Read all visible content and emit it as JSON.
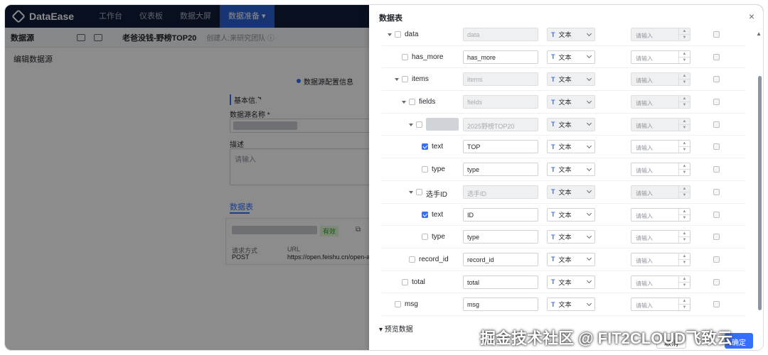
{
  "app": {
    "logo": "DataEase",
    "nav": [
      "工作台",
      "仪表板",
      "数据大屏",
      "数据准备"
    ],
    "active_nav": "数据准备 ▾"
  },
  "subbar": {
    "title": "数据源",
    "datasource_name": "老爸没钱-野榜TOP20",
    "hint": "创建人:来研究团队 ⓘ"
  },
  "edit_title": "编辑数据源",
  "form": {
    "step_label": "数据源配置信息",
    "section_basic": "基本信息",
    "name_label": "数据源名称 *",
    "desc_label": "描述",
    "desc_placeholder": "请输入",
    "tab_tables": "数据表",
    "card_status": "有效",
    "card_method_label": "请求方式",
    "card_method_value": "POST",
    "card_url_label": "URL",
    "card_url_value": "https://open.feishu.cn/open-apis"
  },
  "drawer": {
    "title": "数据表",
    "close": "×",
    "preview_label": "▾ 预览数据",
    "cancel": "取消",
    "ok": "确定",
    "rows": [
      {
        "name": "data",
        "field": "data",
        "type": "文本",
        "checked": false,
        "indent": 0,
        "caret": true,
        "disabled": true
      },
      {
        "name": "has_more",
        "field": "has_more",
        "type": "文本",
        "checked": false,
        "indent": 1,
        "caret": false,
        "disabled": false
      },
      {
        "name": "items",
        "field": "items",
        "type": "文本",
        "checked": false,
        "indent": 1,
        "caret": true,
        "disabled": true
      },
      {
        "name": "fields",
        "field": "fields",
        "type": "文本",
        "checked": false,
        "indent": 2,
        "caret": true,
        "disabled": true
      },
      {
        "name": "",
        "field": "2025野榜TOP20",
        "type": "文本",
        "checked": false,
        "indent": 3,
        "caret": true,
        "disabled": true,
        "blurred": true
      },
      {
        "name": "text",
        "field": "TOP",
        "type": "文本",
        "checked": true,
        "indent": 4,
        "caret": false,
        "disabled": false
      },
      {
        "name": "type",
        "field": "type",
        "type": "文本",
        "checked": false,
        "indent": 4,
        "caret": false,
        "disabled": false
      },
      {
        "name": "选手ID",
        "field": "选手ID",
        "type": "文本",
        "checked": false,
        "indent": 3,
        "caret": true,
        "disabled": true
      },
      {
        "name": "text",
        "field": "ID",
        "type": "文本",
        "checked": true,
        "indent": 4,
        "caret": false,
        "disabled": false
      },
      {
        "name": "type",
        "field": "type",
        "type": "文本",
        "checked": false,
        "indent": 4,
        "caret": false,
        "disabled": false
      },
      {
        "name": "record_id",
        "field": "record_id",
        "type": "文本",
        "checked": false,
        "indent": 2,
        "caret": false,
        "disabled": false
      },
      {
        "name": "total",
        "field": "total",
        "type": "文本",
        "checked": false,
        "indent": 1,
        "caret": false,
        "disabled": false
      },
      {
        "name": "msg",
        "field": "msg",
        "type": "文本",
        "checked": false,
        "indent": 0,
        "caret": false,
        "disabled": false
      }
    ],
    "number_placeholder": "请输入",
    "type_icon": "T"
  },
  "watermark": "掘金技术社区 @ FIT2CLOUD飞致云"
}
